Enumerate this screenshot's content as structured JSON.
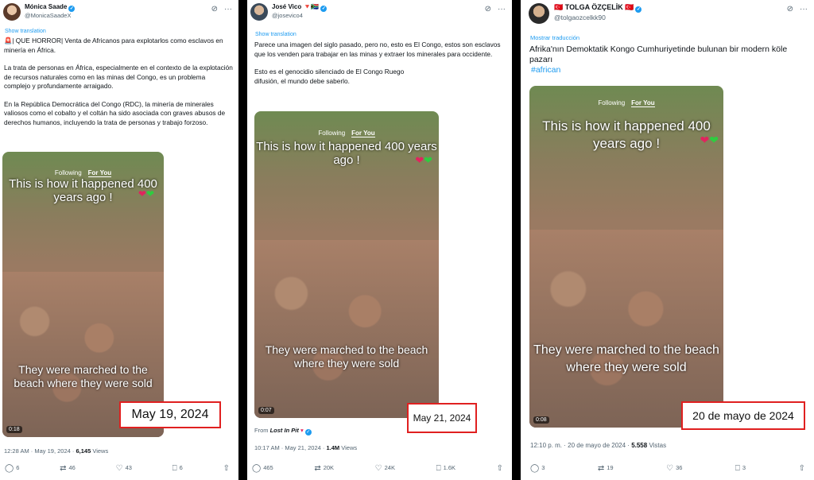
{
  "tweets": [
    {
      "author": "Mónica Saade",
      "handle": "@MonicaSaadeX",
      "translate_label": "Show translation",
      "paragraphs": [
        "🚨| QUE HORROR| Venta de Africanos para explotarlos como esclavos en minería en África.",
        "La trata de personas en África, especialmente en el contexto de la explotación de recursos naturales como en las minas del Congo, es un problema complejo y profundamente arraigado.",
        "En la República Democrática del Congo (RDC), la minería de minerales valiosos como el cobalto y el coltán ha sido asociada con graves abusos de derechos humanos, incluyendo la trata de personas y trabajo forzoso."
      ],
      "video": {
        "tab_following": "Following",
        "tab_foryou": "For You",
        "title": "This is how it happened 400 years ago !",
        "caption": "They were marched to the beach where they were sold",
        "duration": "0:18"
      },
      "highlighted_date": "May 19, 2024",
      "meta_time": "12:28 AM · May 19, 2024 · ",
      "meta_views": "6,145",
      "meta_views_label": " Views",
      "actions": {
        "replies": "6",
        "reposts": "46",
        "likes": "43",
        "bookmarks": "6"
      }
    },
    {
      "author": "José Vico",
      "author_flags": "🔻🇿🇦",
      "handle": "@josevico4",
      "translate_label": "Show translation",
      "paragraphs": [
        "Parece una imagen del siglo pasado, pero no, esto es El Congo, estos son esclavos que los venden para trabajar en las minas y extraer los minerales para occidente.",
        "Esto es el genocidio silenciado de El Congo Ruego difusión, el mundo debe saberlo."
      ],
      "video": {
        "tab_following": "Following",
        "tab_foryou": "For You",
        "title": "This is how it happened 400 years ago !",
        "caption": "They were marched to the beach where they were sold",
        "duration": "0:07"
      },
      "highlighted_date": "May 21, 2024",
      "from_label": "From ",
      "from_source": "Lost In Pit",
      "meta_time": "10:17 AM · May 21, 2024 · ",
      "meta_views": "1.4M",
      "meta_views_label": " Views",
      "actions": {
        "replies": "465",
        "reposts": "20K",
        "likes": "24K",
        "bookmarks": "1.6K"
      }
    },
    {
      "author": "TOLGA ÖZÇELİK",
      "author_flags": "🇹🇷",
      "handle": "@tolgaozcelkk90",
      "translate_label": "Mostrar traducción",
      "paragraphs": [
        "Afrika'nın Demoktatik Kongo Cumhuriyetinde bulunan bir modern köle pazarı"
      ],
      "hashtag": "#african",
      "video": {
        "tab_following": "Following",
        "tab_foryou": "For You",
        "title": "This is how it happened 400 years ago !",
        "caption": "They were marched to the beach where they were sold",
        "duration": "0:08"
      },
      "highlighted_date": "20 de mayo de 2024",
      "meta_time": "12:10 p. m. · 20 de mayo de 2024 · ",
      "meta_views": "5.558",
      "meta_views_label": " Vistas",
      "actions": {
        "replies": "3",
        "reposts": "19",
        "likes": "36",
        "bookmarks": "3"
      }
    }
  ],
  "colors": {
    "accent": "#1d9bf0",
    "highlight_border": "#e02020",
    "muted": "#536471"
  },
  "icons": [
    "grok-icon",
    "more-icon",
    "reply-icon",
    "repost-icon",
    "like-icon",
    "bookmark-icon",
    "share-icon",
    "verified-icon"
  ]
}
